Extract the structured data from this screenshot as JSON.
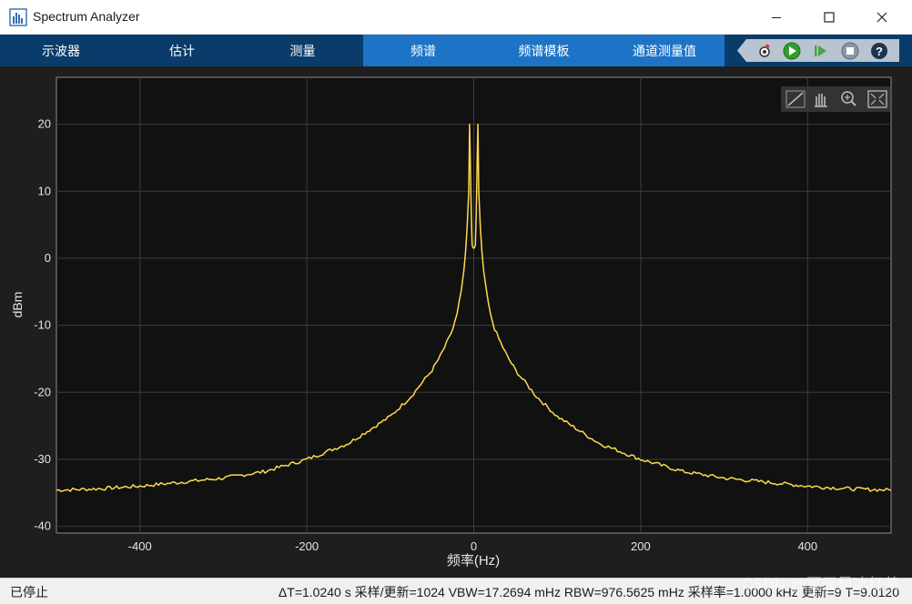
{
  "window": {
    "title": "Spectrum Analyzer"
  },
  "tabs": [
    {
      "label": "示波器"
    },
    {
      "label": "估计"
    },
    {
      "label": "测量"
    },
    {
      "label": "频谱"
    },
    {
      "label": "频谱模板"
    },
    {
      "label": "通道测量值"
    }
  ],
  "status": {
    "state": "已停止",
    "info": "ΔT=1.0240 s  采样/更新=1024  VBW=17.2694 mHz  RBW=976.5625 mHz  采样率=1.0000 kHz  更新=9  T=9.0120"
  },
  "watermark": "CSDN @夏天是冰红茶",
  "colors": {
    "trace": "#ffd94a",
    "plot_bg": "#111111",
    "tab_dark": "#0a3c6b",
    "tab_active": "#1d74c6"
  },
  "plot_tools": [
    "zoom-region-icon",
    "pan-icon",
    "zoom-in-icon",
    "fit-icon"
  ],
  "chart_data": {
    "type": "line",
    "title": "",
    "xlabel": "频率(Hz)",
    "ylabel": "dBm",
    "xlim": [
      -500,
      500
    ],
    "ylim": [
      -41,
      27
    ],
    "xticks": [
      -400,
      -200,
      0,
      200,
      400
    ],
    "yticks": [
      20,
      10,
      0,
      -10,
      -20,
      -30,
      -40
    ],
    "grid": true,
    "series": [
      {
        "color": "#ffd94a",
        "x": [
          -500,
          -450,
          -400,
          -350,
          -300,
          -250,
          -200,
          -150,
          -100,
          -75,
          -50,
          -40,
          -30,
          -25,
          -20,
          -15,
          -12,
          -10,
          -8,
          -6,
          -5,
          -4,
          -3,
          -2,
          -1,
          0,
          1,
          2,
          3,
          4,
          5,
          6,
          8,
          10,
          12,
          15,
          20,
          25,
          30,
          40,
          50,
          75,
          100,
          150,
          200,
          250,
          300,
          350,
          400,
          450,
          500
        ],
        "y": [
          -34.6,
          -34.4,
          -34.0,
          -33.4,
          -32.8,
          -31.8,
          -30.0,
          -27.6,
          -23.6,
          -20.6,
          -16.7,
          -14.6,
          -12.0,
          -10.5,
          -8.4,
          -4.9,
          -2.0,
          0.6,
          4.5,
          10.0,
          20.0,
          14.0,
          7.0,
          2.0,
          1.6,
          1.5,
          1.6,
          2.0,
          7.0,
          14.0,
          20.0,
          10.0,
          4.5,
          0.6,
          -2.0,
          -4.9,
          -8.4,
          -10.5,
          -12.0,
          -14.6,
          -16.7,
          -20.6,
          -23.6,
          -27.6,
          -30.0,
          -31.8,
          -32.8,
          -33.4,
          -34.0,
          -34.4,
          -34.6
        ]
      }
    ]
  }
}
